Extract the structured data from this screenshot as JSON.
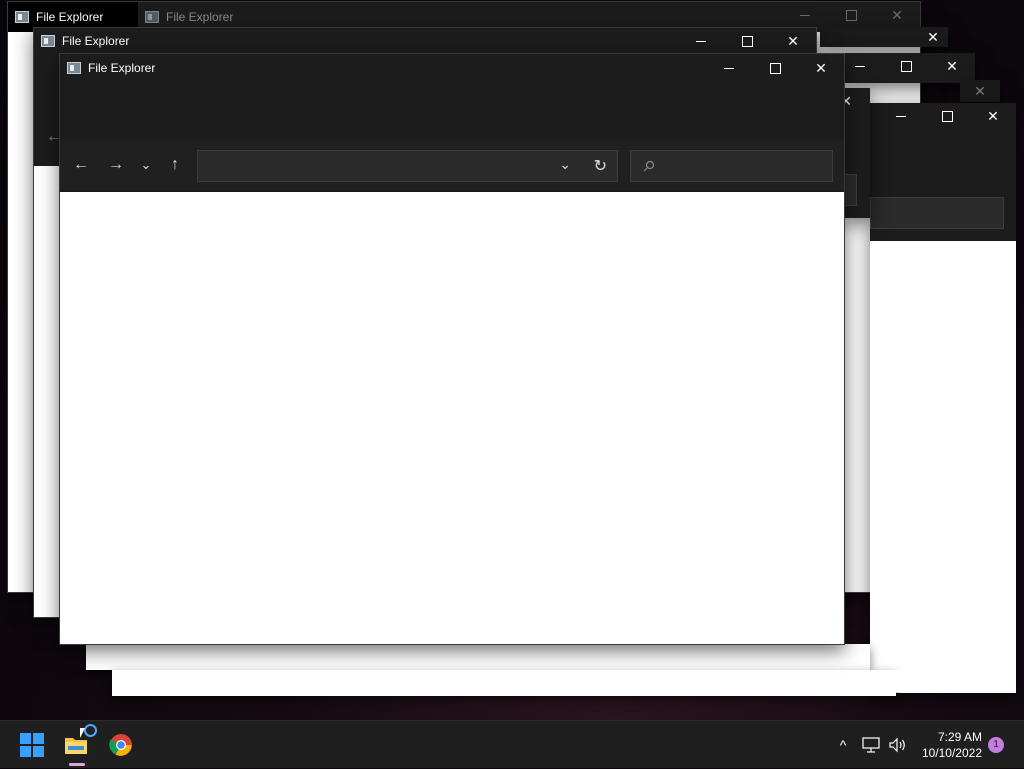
{
  "window_title": "File Explorer",
  "back_window_tabs": [
    "File Explorer",
    "File Explorer"
  ],
  "controls": {
    "minimize": "—",
    "maximize": "☐",
    "close": "✕"
  },
  "nav": {
    "back": "←",
    "forward": "→",
    "recent": "⌄",
    "up": "↑",
    "address_dropdown": "⌄",
    "refresh": "↻"
  },
  "address_value": "",
  "search_placeholder": "",
  "taskbar": {
    "time": "7:29 AM",
    "date": "10/10/2022",
    "notification_count": "1",
    "icons": [
      "start-icon",
      "file-explorer-icon",
      "chrome-icon"
    ],
    "tray_icons": [
      "chevron-up-icon",
      "network-icon",
      "speaker-icon"
    ]
  },
  "colors": {
    "accent": "#0078d4",
    "titlebar": "#1c1c1c",
    "taskbar": "#1f1f1f",
    "badge": "#c67de0"
  }
}
